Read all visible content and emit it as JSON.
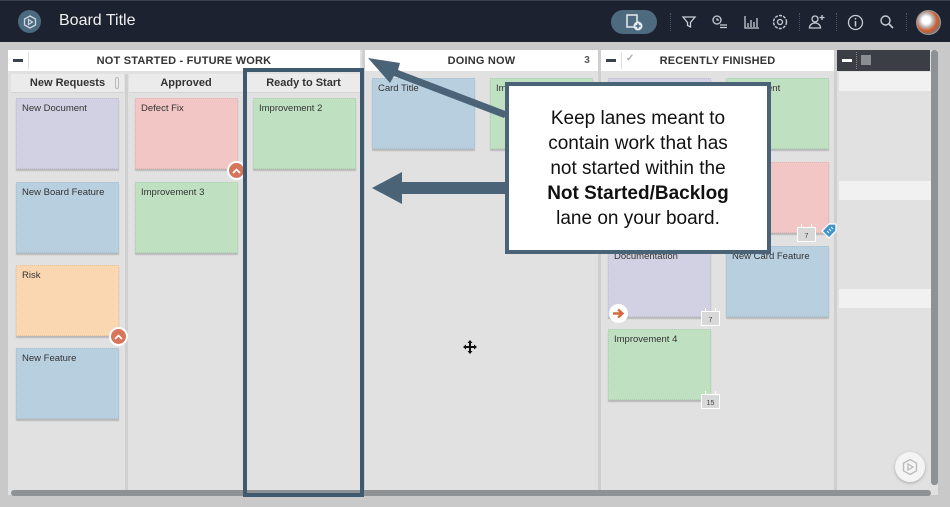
{
  "header": {
    "board_title": "Board Title",
    "icons": [
      "add-card-icon",
      "filter-icon",
      "timeline-icon",
      "analytics-icon",
      "settings-icon",
      "add-user-icon",
      "info-icon",
      "search-icon",
      "avatar"
    ]
  },
  "lanes": {
    "not_started": {
      "title": "NOT STARTED - FUTURE WORK",
      "sublanes": [
        {
          "title": "New Requests",
          "cards": [
            {
              "title": "New Document",
              "color": "#d2d1e3"
            },
            {
              "title": "New Board Feature",
              "color": "#b7cfdf"
            },
            {
              "title": "Risk",
              "color": "#fad7b0"
            },
            {
              "title": "New Feature",
              "color": "#b7cfdf"
            }
          ]
        },
        {
          "title": "Approved",
          "cards": [
            {
              "title": "Defect Fix",
              "color": "#f1c6c5"
            },
            {
              "title": "Improvement 3",
              "color": "#c0e0c2"
            }
          ]
        },
        {
          "title": "Ready to Start",
          "cards": [
            {
              "title": "Improvement 2",
              "color": "#c0e0c2"
            }
          ]
        }
      ]
    },
    "doing_now": {
      "title": "DOING NOW",
      "count": "3",
      "cards": [
        {
          "title": "Card Title",
          "color": "#b7cfdf"
        },
        {
          "title": "Im",
          "color": "#c0e0c2"
        }
      ]
    },
    "recently_finished": {
      "title": "RECENTLY FINISHED",
      "cards": [
        {
          "title": "ent",
          "color": "#c0e0c2"
        },
        {
          "title": "",
          "color": "#f1c6c5",
          "date_badge": "7"
        },
        {
          "title": "Documentation",
          "color": "#d2d1e3",
          "date_badge": "7"
        },
        {
          "title": "New Card Feature",
          "color": "#b7cfdf"
        },
        {
          "title": "Improvement 4",
          "color": "#c0e0c2",
          "date_badge": "15"
        }
      ]
    }
  },
  "callout": {
    "line1": "Keep lanes meant to",
    "line2": "contain work that has",
    "line3": "not started within the",
    "bold": "Not Started/Backlog",
    "line5": "lane on your board."
  },
  "colors": {
    "topbar": "#1d2231",
    "accent": "#4a6377",
    "chevron": "#d5765a"
  }
}
